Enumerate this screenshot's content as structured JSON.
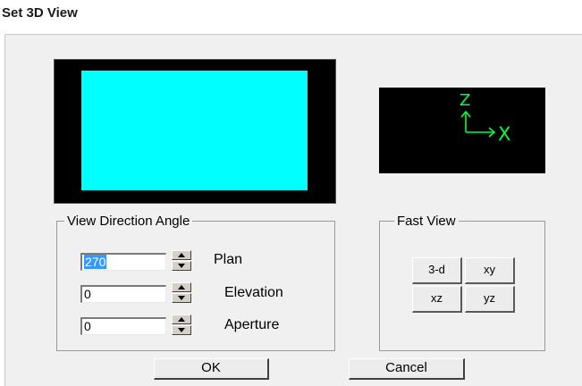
{
  "window": {
    "title": "Set 3D View"
  },
  "axes": {
    "vertical_label": "Z",
    "horizontal_label": "X",
    "color": "#00ff3c"
  },
  "preview": {
    "fill_color": "#00ffff"
  },
  "view_direction": {
    "group_title": "View Direction Angle",
    "plan": {
      "value": "270",
      "label": "Plan"
    },
    "elevation": {
      "value": "0",
      "label": "Elevation"
    },
    "aperture": {
      "value": "0",
      "label": "Aperture"
    }
  },
  "fast_view": {
    "group_title": "Fast View",
    "buttons": {
      "three_d": "3-d",
      "xy": "xy",
      "xz": "xz",
      "yz": "yz"
    }
  },
  "buttons": {
    "ok": "OK",
    "cancel": "Cancel"
  }
}
